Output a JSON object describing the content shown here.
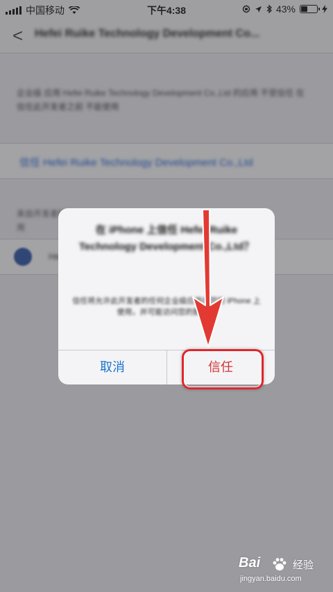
{
  "status_bar": {
    "carrier": "中国移动",
    "time": "下午4:38",
    "battery": "43%",
    "battery_level": 0.43
  },
  "nav": {
    "back_glyph": "<",
    "title": "Hefei Ruike Technology Development Co..."
  },
  "page": {
    "description": "企业级 应用 Hefei Ruike Technology Development Co.,Ltd 的应用 不受信任 在信任此开发者之前 不能使用",
    "link_text": "信任 Hefei Ruike Technology Development Co.,Ltd",
    "section_label": "来自开发者的应用",
    "app_name": "Hefei Ruike Technology Development Co.,Ltd"
  },
  "alert": {
    "title": "在 iPhone 上信任 Hefei Ruike Technology Development Co.,Ltd？",
    "message": "信任将允许此开发者的任何企业级应用在您的 iPhone 上使用，并可能访问您的数据。",
    "cancel_label": "取消",
    "trust_label": "信任"
  },
  "watermark": {
    "brand": "Bai",
    "brand_suffix": "经验",
    "url": "jingyan.baidu.com"
  },
  "colors": {
    "accent_blue": "#1a73d0",
    "trust_red": "#d33333",
    "annotation_red": "#e0262a"
  }
}
